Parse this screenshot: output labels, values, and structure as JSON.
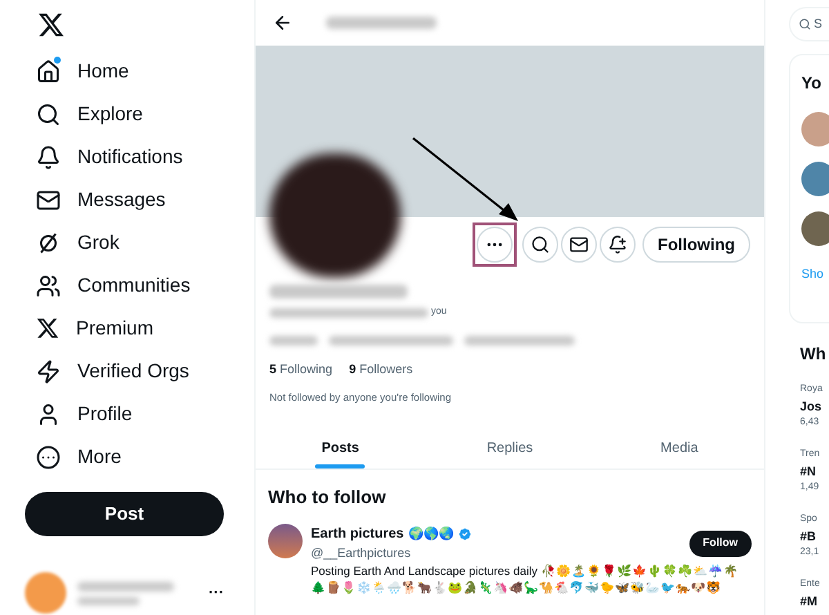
{
  "nav": {
    "items": [
      {
        "label": "Home",
        "unread": true
      },
      {
        "label": "Explore",
        "unread": false
      },
      {
        "label": "Notifications",
        "unread": false
      },
      {
        "label": "Messages",
        "unread": false
      },
      {
        "label": "Grok",
        "unread": false
      },
      {
        "label": "Communities",
        "unread": false
      },
      {
        "label": "Premium",
        "unread": false
      },
      {
        "label": "Verified Orgs",
        "unread": false
      },
      {
        "label": "Profile",
        "unread": false
      },
      {
        "label": "More",
        "unread": false
      }
    ],
    "post_button": "Post",
    "account_menu": "···"
  },
  "profile": {
    "actions": [
      {
        "kind": "more",
        "highlighted": true
      },
      {
        "kind": "search",
        "highlighted": false
      },
      {
        "kind": "message",
        "highlighted": false
      },
      {
        "kind": "notify",
        "highlighted": false
      }
    ],
    "following_button": "Following",
    "handle_suffix": "you",
    "stats": [
      {
        "count": "5",
        "label": "Following"
      },
      {
        "count": "9",
        "label": "Followers"
      }
    ],
    "followed_by": "Not followed by anyone you're following"
  },
  "tabs": [
    {
      "label": "Posts",
      "selected": true
    },
    {
      "label": "Replies",
      "selected": false
    },
    {
      "label": "Media",
      "selected": false
    }
  ],
  "who_to_follow": {
    "title": "Who to follow",
    "accounts": [
      {
        "name": "Earth pictures",
        "name_emoji": "🌍🌎🌏",
        "verified": true,
        "handle": "@__Earthpictures",
        "bio": "Posting Earth And Landscape pictures daily 🥀🌼🏝️🌻🌹🌿🍁🌵🍀☘️⛅☔🌴🌲🪵🌷❄️🌦️🌧️🐕🐂🐇🐸🐊🦎🦄🐗🦕🐪🐔🐬🐳🐤🦋🐝🦢🐦🐅🐶🐯",
        "button": "Follow"
      }
    ]
  },
  "right": {
    "search_placeholder": "S",
    "you_title": "Yo",
    "show_more": "Sho",
    "whats_title": "Wh",
    "trends": [
      {
        "category": "Roya",
        "title": "Jos",
        "count": "6,43"
      },
      {
        "category": "Tren",
        "title": "#N",
        "count": "1,49"
      },
      {
        "category": "Spo",
        "title": "#B",
        "count": "23,1"
      },
      {
        "category": "Ente",
        "title": "#M"
      }
    ]
  }
}
